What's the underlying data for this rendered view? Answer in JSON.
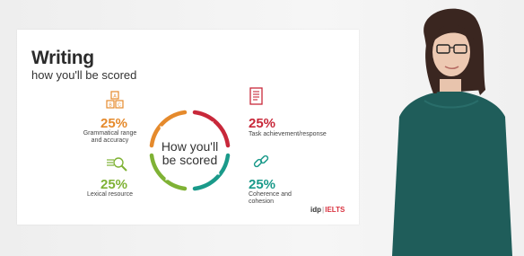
{
  "slide": {
    "title": "Writing",
    "subtitle": "how you'll be scored",
    "center_line1": "How you'll",
    "center_line2": "be scored",
    "criteria": [
      {
        "percent": "25%",
        "line1": "Grammatical range",
        "line2": "and accuracy",
        "color": "#e58a2c",
        "icon": "abc-blocks-icon"
      },
      {
        "percent": "25%",
        "line1": "Lexical resource",
        "line2": "",
        "color": "#7fb235",
        "icon": "magnifier-icon"
      },
      {
        "percent": "25%",
        "line1": "Task achievement/response",
        "line2": "",
        "color": "#c8283a",
        "icon": "document-icon"
      },
      {
        "percent": "25%",
        "line1": "Coherence and",
        "line2": "cohesion",
        "color": "#1a9a8a",
        "icon": "chain-link-icon"
      }
    ],
    "brand": {
      "idp": "idp",
      "sep": "|",
      "ielts": "IELTS"
    }
  },
  "colors": {
    "orange": "#e58a2c",
    "red": "#c8283a",
    "green": "#7fb235",
    "teal": "#1a9a8a"
  }
}
